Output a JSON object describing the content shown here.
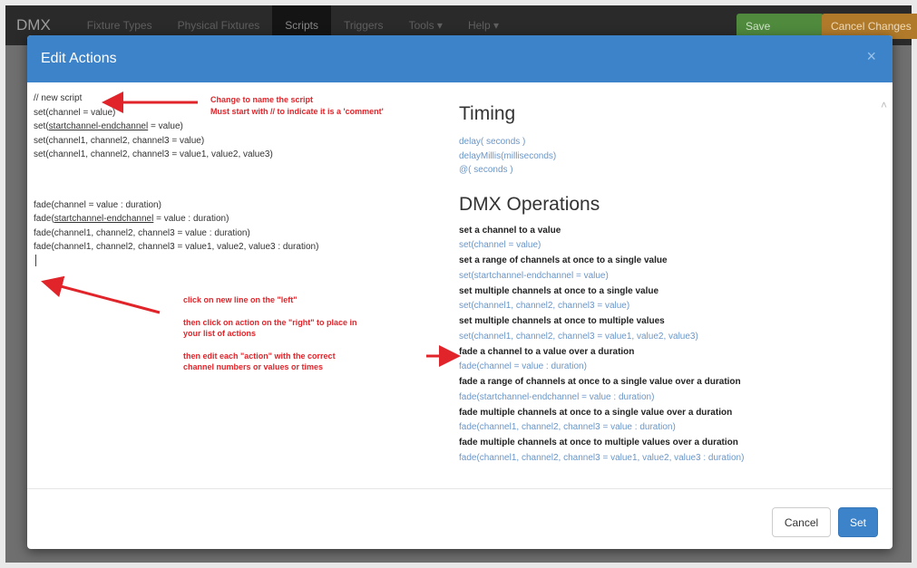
{
  "navbar": {
    "brand": "DMX",
    "items": [
      "Fixture Types",
      "Physical Fixtures",
      "Scripts",
      "Triggers",
      "Tools ▾",
      "Help ▾"
    ],
    "save_button": "Save Changes",
    "cancel_button": "Cancel Changes"
  },
  "modal": {
    "title": "Edit Actions",
    "close_glyph": "×",
    "scroll_glyph": "˄",
    "cancel_label": "Cancel",
    "set_label": "Set"
  },
  "editor": {
    "lines_block1": [
      "// new script",
      "set(channel = value)",
      "set(startchannel-endchannel = value)",
      "set(channel1, channel2, channel3 = value)",
      "set(channel1, channel2, channel3 = value1, value2, value3)"
    ],
    "lines_block2": [
      "fade(channel = value : duration)",
      "fade(startchannel-endchannel = value : duration)",
      "fade(channel1, channel2, channel3 = value : duration)",
      "fade(channel1, channel2, channel3 = value1, value2, value3 : duration)"
    ]
  },
  "timing": {
    "heading": "Timing",
    "links": [
      "delay( seconds )",
      "delayMillis(milliseconds)",
      "@( seconds )"
    ]
  },
  "dmx_ops": {
    "heading": "DMX Operations",
    "ops": [
      {
        "desc": "set a channel to a value",
        "action": "set(channel = value)"
      },
      {
        "desc": "set a range of channels at once to a single value",
        "action": "set(startchannel-endchannel = value)"
      },
      {
        "desc": "set multiple channels at once to a single value",
        "action": "set(channel1, channel2, channel3 = value)"
      },
      {
        "desc": "set multiple channels at once to multiple values",
        "action": "set(channel1, channel2, channel3 = value1, value2, value3)"
      },
      {
        "desc": "fade a channel to a value over a duration",
        "action": "fade(channel = value : duration)"
      },
      {
        "desc": "fade a range of channels at once to a single value over a duration",
        "action": "fade(startchannel-endchannel = value : duration)"
      },
      {
        "desc": "fade multiple channels at once to a single value over a duration",
        "action": "fade(channel1, channel2, channel3 = value : duration)"
      },
      {
        "desc": "fade multiple channels at once to multiple values over a duration",
        "action": "fade(channel1, channel2, channel3 = value1, value2, value3 : duration)"
      }
    ]
  },
  "annotations": {
    "note1": [
      "Change to name the script",
      "Must start with // to indicate it is a 'comment'"
    ],
    "note2": [
      "click on new line on the \"left\"",
      "",
      "then click on action on the \"right\" to place in",
      "your list of actions",
      "",
      "then edit each \"action\" with the correct",
      "channel numbers or values or times"
    ]
  },
  "colors": {
    "header_blue": "#3c83c9",
    "link_blue": "#6b96c7",
    "annotation_red": "#e0242a"
  }
}
